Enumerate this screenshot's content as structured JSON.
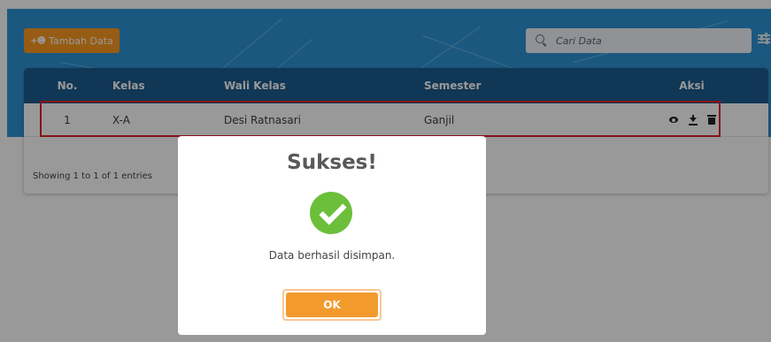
{
  "toolbar": {
    "add_label": "Tambah Data",
    "add_icon": "user-plus-icon",
    "search_placeholder": "Cari Data",
    "filter_icon": "sliders-icon"
  },
  "table": {
    "headers": {
      "no": "No.",
      "kelas": "Kelas",
      "wali": "Wali Kelas",
      "semester": "Semester",
      "aksi": "Aksi"
    },
    "rows": [
      {
        "no": "1",
        "kelas": "X-A",
        "wali": "Desi Ratnasari",
        "semester": "Ganjil",
        "actions": [
          "eye-icon",
          "download-icon",
          "trash-icon"
        ]
      }
    ],
    "footer": "Showing 1 to 1 of 1 entries"
  },
  "modal": {
    "title": "Sukses!",
    "icon": "check-circle-icon",
    "message": "Data berhasil disimpan.",
    "ok_label": "OK"
  },
  "colors": {
    "hero": "#2e93d6",
    "table_header": "#1b5d8e",
    "accent_orange": "#fb9a22",
    "success_green": "#6cbf3b",
    "highlight_red": "#e2202b"
  }
}
